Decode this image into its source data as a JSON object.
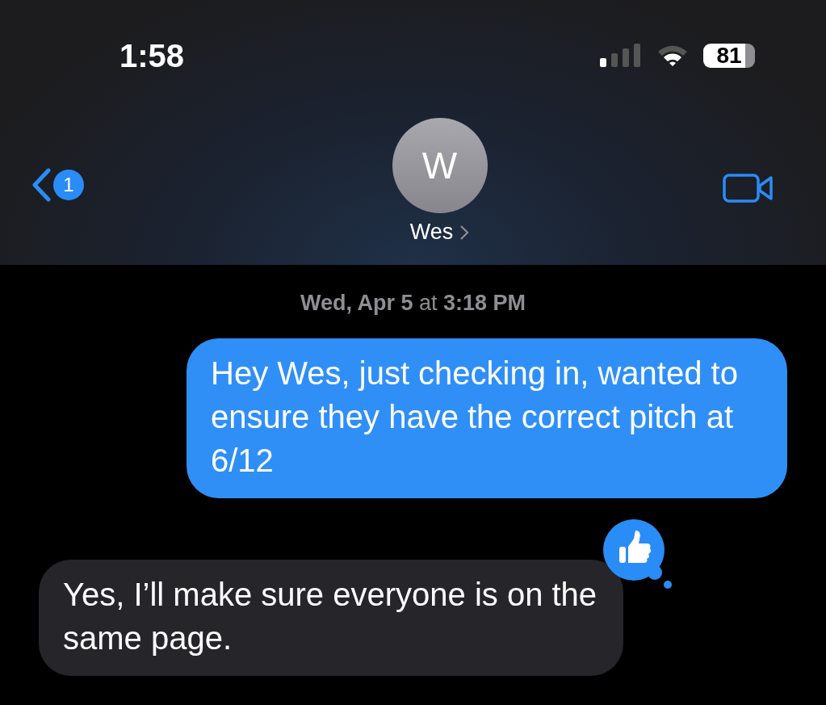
{
  "status_bar": {
    "time": "1:58",
    "battery": "81"
  },
  "header": {
    "back_badge": "1",
    "avatar_initial": "W",
    "contact_name": "Wes"
  },
  "timestamp": "**Wed, Apr 5** at **3:18 PM**",
  "messages": [
    {
      "kind": "sent",
      "text": "Hey Wes, just checking in, wanted to ensure they have the correct pitch at 6/12",
      "reacted": false
    },
    {
      "kind": "received",
      "text": "Yes, I’ll make sure everyone is on the same page.",
      "reacted": true
    }
  ]
}
